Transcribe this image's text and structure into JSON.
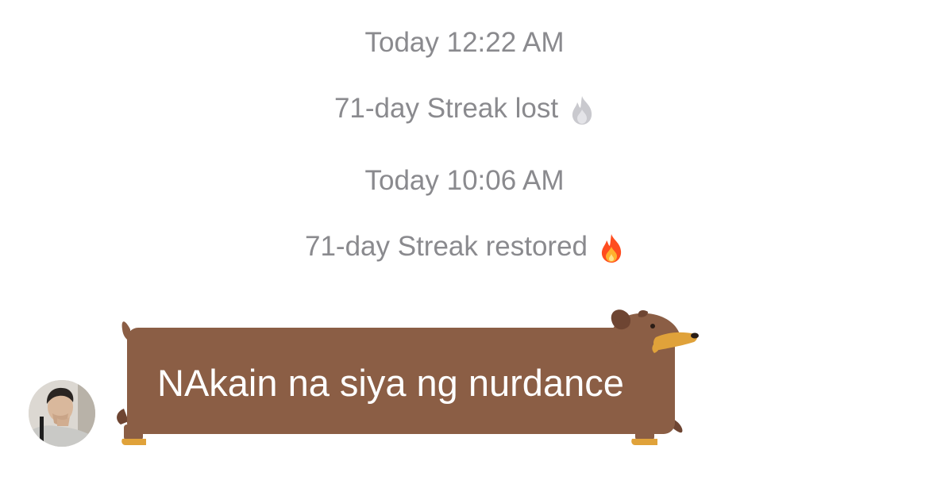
{
  "chat": {
    "timestamp_1": "Today 12:22 AM",
    "event_1": "71-day Streak lost",
    "timestamp_2": "Today 10:06 AM",
    "event_2": "71-day Streak restored",
    "message": {
      "text": "NAkain na siya ng nurdance",
      "bubble_style": "dachshund-sticker-bubble",
      "bubble_color": "#8b5e45"
    }
  },
  "icons": {
    "streak_lost": "grey-flame-icon",
    "streak_restored": "fire-icon",
    "sender": "avatar"
  },
  "colors": {
    "system_text": "#8a8a8e",
    "background": "#ffffff",
    "flame_lost": "#c7c7cc",
    "flame_active": "#ff5a1f"
  }
}
